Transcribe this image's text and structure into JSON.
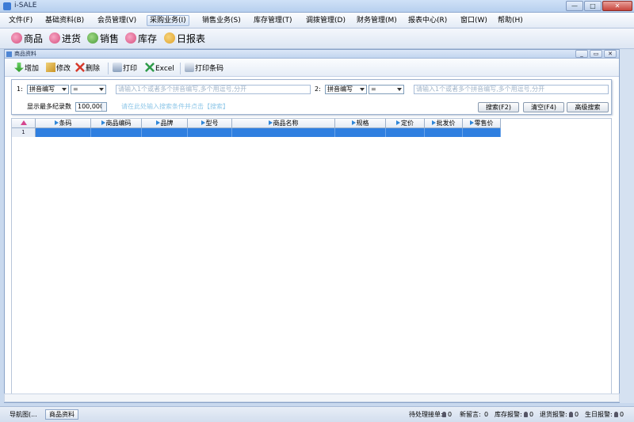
{
  "app": {
    "title": "i-SALE"
  },
  "window_controls": {
    "minimize": "—",
    "maximize": "□",
    "close": "✕"
  },
  "menu": [
    {
      "label": "文件(F)"
    },
    {
      "label": "基础资料(B)"
    },
    {
      "label": "会员管理(V)"
    },
    {
      "label": "采购业务(I)"
    },
    {
      "label": "销售业务(S)"
    },
    {
      "label": "库存管理(T)"
    },
    {
      "label": "调拨管理(D)"
    },
    {
      "label": "财务管理(M)"
    },
    {
      "label": "报表中心(R)"
    },
    {
      "label": "窗口(W)"
    },
    {
      "label": "帮助(H)"
    }
  ],
  "big_toolbar": [
    {
      "label": "商品",
      "icon": "goods-icon",
      "color": "#d64f7e"
    },
    {
      "label": "进货",
      "icon": "purchase-icon",
      "color": "#d64f7e"
    },
    {
      "label": "销售",
      "icon": "sales-icon",
      "color": "#4a9b3a"
    },
    {
      "label": "库存",
      "icon": "stock-icon",
      "color": "#d64f7e"
    },
    {
      "label": "日报表",
      "icon": "daily-report-icon",
      "color": "#e0a22a"
    }
  ],
  "child_window": {
    "title": "商品资料",
    "controls": {
      "minimize": "_",
      "restore": "▭",
      "close": "✕"
    }
  },
  "toolbar": {
    "add": "增加",
    "edit": "修改",
    "delete": "删除",
    "print": "打印",
    "excel": "Excel",
    "print_barcode": "打印条码"
  },
  "search": {
    "row1_label": "1:",
    "row1_field": "拼音编写",
    "row1_operator": "=",
    "row1_placeholder": "请输入1个或者多个拼音编写,多个用逗号,分开",
    "row2_label": "2:",
    "row2_field": "拼音编写",
    "row2_operator": "=",
    "row2_placeholder": "请输入1个或者多个拼音编写,多个用逗号,分开",
    "max_records_label": "显示最多纪录数",
    "max_records_value": "100,000",
    "hint": "请在此处输入搜索条件并点击【搜索】",
    "search_btn": "搜索(F2)",
    "clear_btn": "清空(F4)",
    "advanced_btn": "高级搜索"
  },
  "grid": {
    "columns": [
      "条码",
      "商品编码",
      "品牌",
      "型号",
      "商品名称",
      "规格",
      "定价",
      "批发价",
      "零售价"
    ],
    "rows": [
      {
        "num": "1",
        "cells": [
          "",
          "",
          "",
          "",
          "",
          "",
          "",
          "",
          ""
        ]
      }
    ]
  },
  "status": {
    "nav": "导航图(...",
    "tab": "商品资料",
    "pending_orders_label": "待处理接单:",
    "pending_orders": "0",
    "new_messages_label": "新留言:",
    "new_messages": "0",
    "stock_alert_label": "库存报警:",
    "stock_alert": "0",
    "return_alert_label": "退货报警:",
    "return_alert": "0",
    "birthday_alert_label": "生日报警:",
    "birthday_alert": "0"
  }
}
